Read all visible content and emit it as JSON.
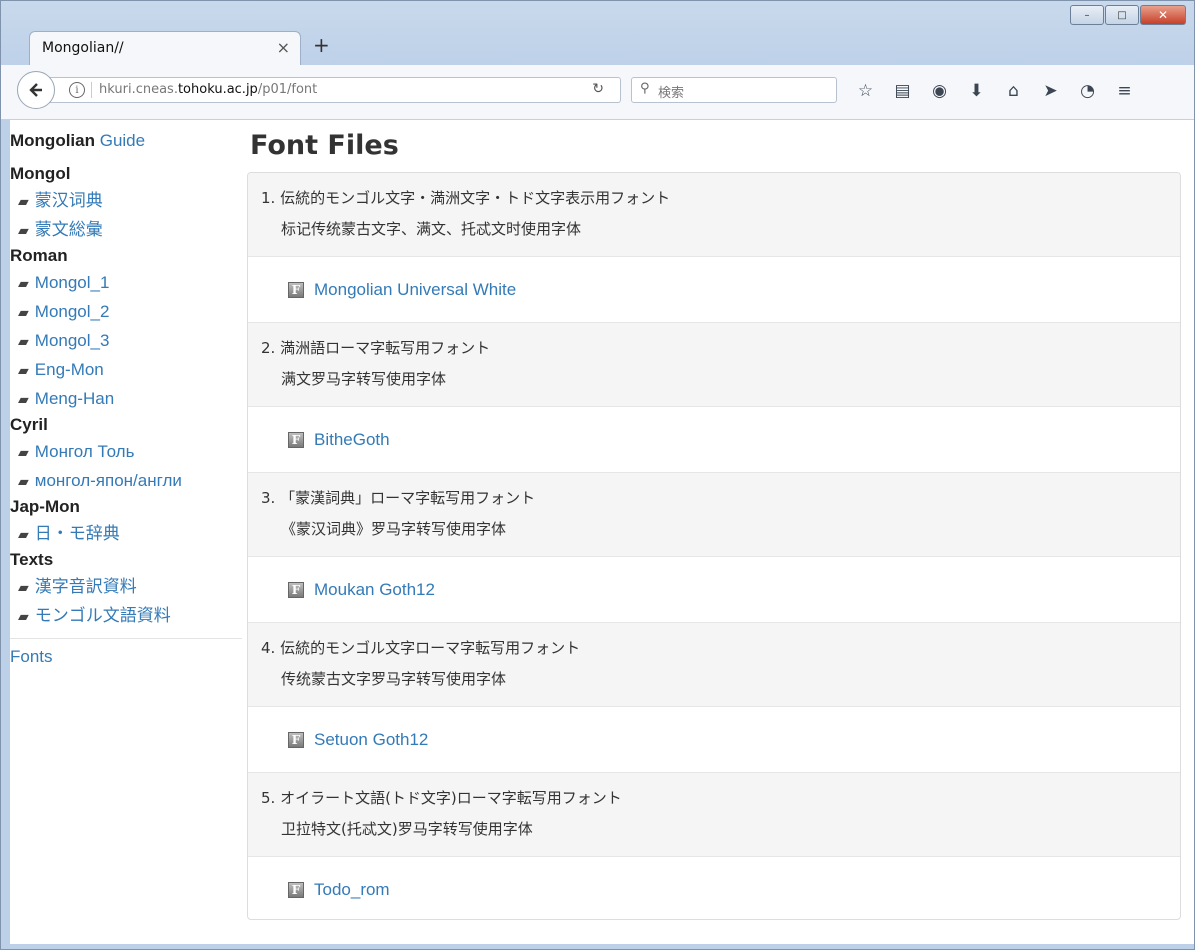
{
  "browser": {
    "tab_title": "Mongolian//",
    "tab_close": "×",
    "new_tab": "+",
    "url_prefix": "hkuri.cneas.",
    "url_domain": "tohoku.ac.jp",
    "url_path": "/p01/font",
    "search_placeholder": "検索",
    "win_minimize": "–",
    "win_maximize": "□",
    "win_close": "✕"
  },
  "sidebar": {
    "brand_bold": "Mongolian",
    "brand_link": "Guide",
    "sections": [
      {
        "heading": "Mongol",
        "items": [
          "蒙汉词典",
          "蒙文総彙"
        ]
      },
      {
        "heading": "Roman",
        "items": [
          "Mongol_1",
          "Mongol_2",
          "Mongol_3",
          "Eng-Mon",
          "Meng-Han"
        ]
      },
      {
        "heading": "Cyril",
        "items": [
          "Монгол Толь",
          "монгол-япон/англи"
        ]
      },
      {
        "heading": "Jap-Mon",
        "items": [
          "日・モ辞典"
        ]
      },
      {
        "heading": "Texts",
        "items": [
          "漢字音訳資料",
          "モンゴル文語資料"
        ]
      }
    ],
    "fonts_link": "Fonts"
  },
  "main": {
    "title": "Font Files",
    "entries": [
      {
        "line1": "1. 伝統的モンゴル文字・満洲文字・トド文字表示用フォント",
        "line2": "标记传统蒙古文字、满文、托忒文时使用字体",
        "font_icon": "F",
        "font_name": "Mongolian Universal White"
      },
      {
        "line1": "2. 満洲語ローマ字転写用フォント",
        "line2": "满文罗马字转写使用字体",
        "font_icon": "F",
        "font_name": "BitheGoth"
      },
      {
        "line1": "3. 「蒙漢詞典」ローマ字転写用フォント",
        "line2": "《蒙汉词典》罗马字转写使用字体",
        "font_icon": "F",
        "font_name": "Moukan Goth12"
      },
      {
        "line1": "4. 伝統的モンゴル文字ローマ字転写用フォント",
        "line2": "传统蒙古文字罗马字转写使用字体",
        "font_icon": "F",
        "font_name": "Setuon Goth12"
      },
      {
        "line1": "5. オイラート文語(トド文字)ローマ字転写用フォント",
        "line2": "卫拉特文(托忒文)罗马字转写使用字体",
        "font_icon": "F",
        "font_name": "Todo_rom"
      }
    ]
  },
  "colors": {
    "link": "#337ab7",
    "row_alt": "#f5f5f5",
    "chrome": "#bcd0e8"
  }
}
